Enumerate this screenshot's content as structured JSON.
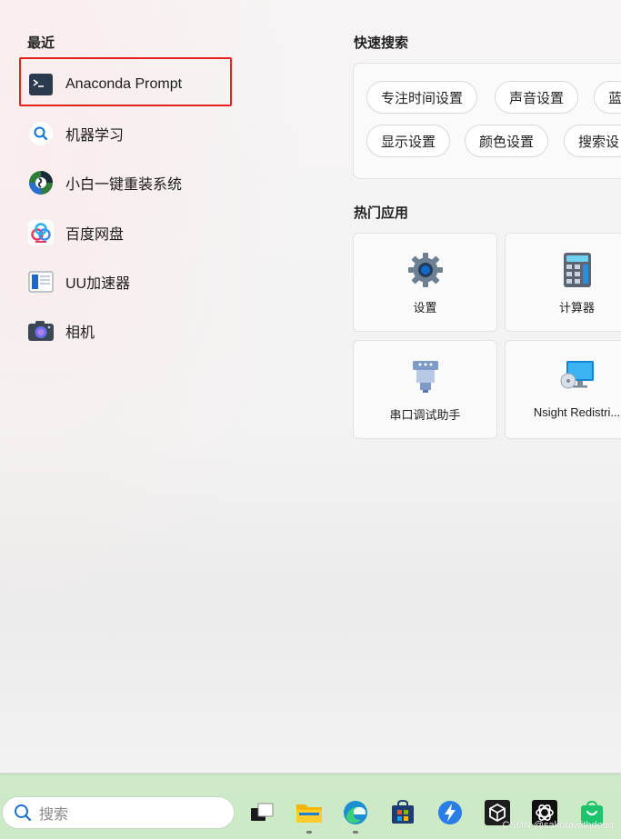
{
  "recent": {
    "title": "最近",
    "items": [
      {
        "label": "Anaconda Prompt",
        "icon": "terminal-icon"
      },
      {
        "label": "机器学习",
        "icon": "search-icon"
      },
      {
        "label": "小白一键重装系统",
        "icon": "xiaobai-icon"
      },
      {
        "label": "百度网盘",
        "icon": "baidu-netdisk-icon"
      },
      {
        "label": "UU加速器",
        "icon": "uu-accelerator-icon"
      },
      {
        "label": "相机",
        "icon": "camera-icon"
      }
    ]
  },
  "quick_search": {
    "title": "快速搜索",
    "chips": [
      "专注时间设置",
      "声音设置",
      "蓝",
      "显示设置",
      "颜色设置",
      "搜索设"
    ]
  },
  "hot_apps": {
    "title": "热门应用",
    "apps": [
      {
        "label": "设置",
        "icon": "gear-icon"
      },
      {
        "label": "计算器",
        "icon": "calculator-icon"
      },
      {
        "label": "串口调试助手",
        "icon": "serial-port-icon"
      },
      {
        "label": "Nsight Redistri...",
        "icon": "monitor-disc-icon"
      }
    ]
  },
  "taskbar": {
    "search_placeholder": "搜索",
    "apps": [
      "task-view-icon",
      "file-explorer-icon",
      "edge-icon",
      "microsoft-store-icon",
      "lightning-app-icon",
      "unity-icon",
      "openai-icon",
      "shopping-bag-icon"
    ]
  },
  "watermark": "CSDN @sakurawithdong",
  "colors": {
    "highlight": "#e3221a",
    "taskbar": "#cdeac7",
    "accent": "#0067c0"
  }
}
